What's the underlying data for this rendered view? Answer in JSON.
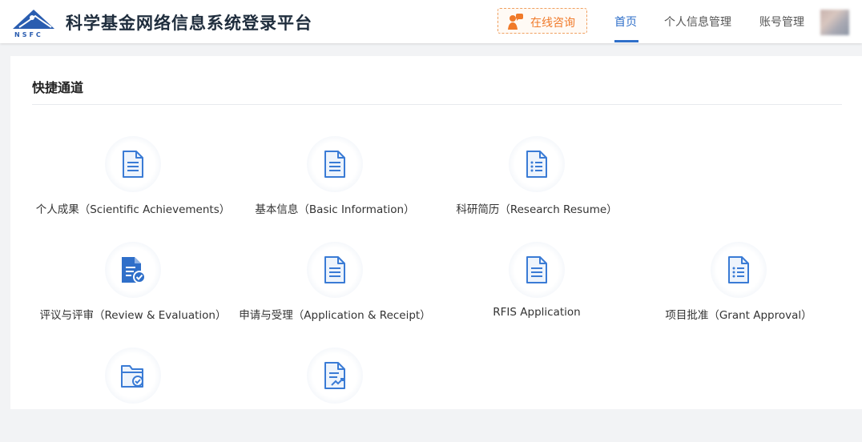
{
  "header": {
    "logo_text": "NSFC",
    "title": "科学基金网络信息系统登录平台",
    "consult_label": "在线咨询",
    "nav": [
      {
        "label": "首页",
        "active": true
      },
      {
        "label": "个人信息管理",
        "active": false
      },
      {
        "label": "账号管理",
        "active": false
      }
    ]
  },
  "quick_access": {
    "title": "快捷通道",
    "tiles": [
      {
        "label": "个人成果（Scientific Achievements）",
        "icon": "document-icon"
      },
      {
        "label": "基本信息（Basic Information）",
        "icon": "document-icon"
      },
      {
        "label": "科研简历（Research Resume）",
        "icon": "checklist-document-icon"
      },
      {
        "label": "评议与评审（Review & Evaluation）",
        "icon": "document-check-icon"
      },
      {
        "label": "申请与受理（Application & Receipt）",
        "icon": "document-icon"
      },
      {
        "label": "RFIS Application",
        "icon": "document-icon"
      },
      {
        "label": "项目批准（Grant Approval）",
        "icon": "checklist-document-icon"
      },
      {
        "label": "",
        "icon": "folder-check-icon"
      },
      {
        "label": "",
        "icon": "document-chart-icon"
      }
    ]
  },
  "colors": {
    "primary": "#2f6fc9",
    "icon_blue": "#3a7bd5",
    "consult_orange": "#f07a2a"
  }
}
